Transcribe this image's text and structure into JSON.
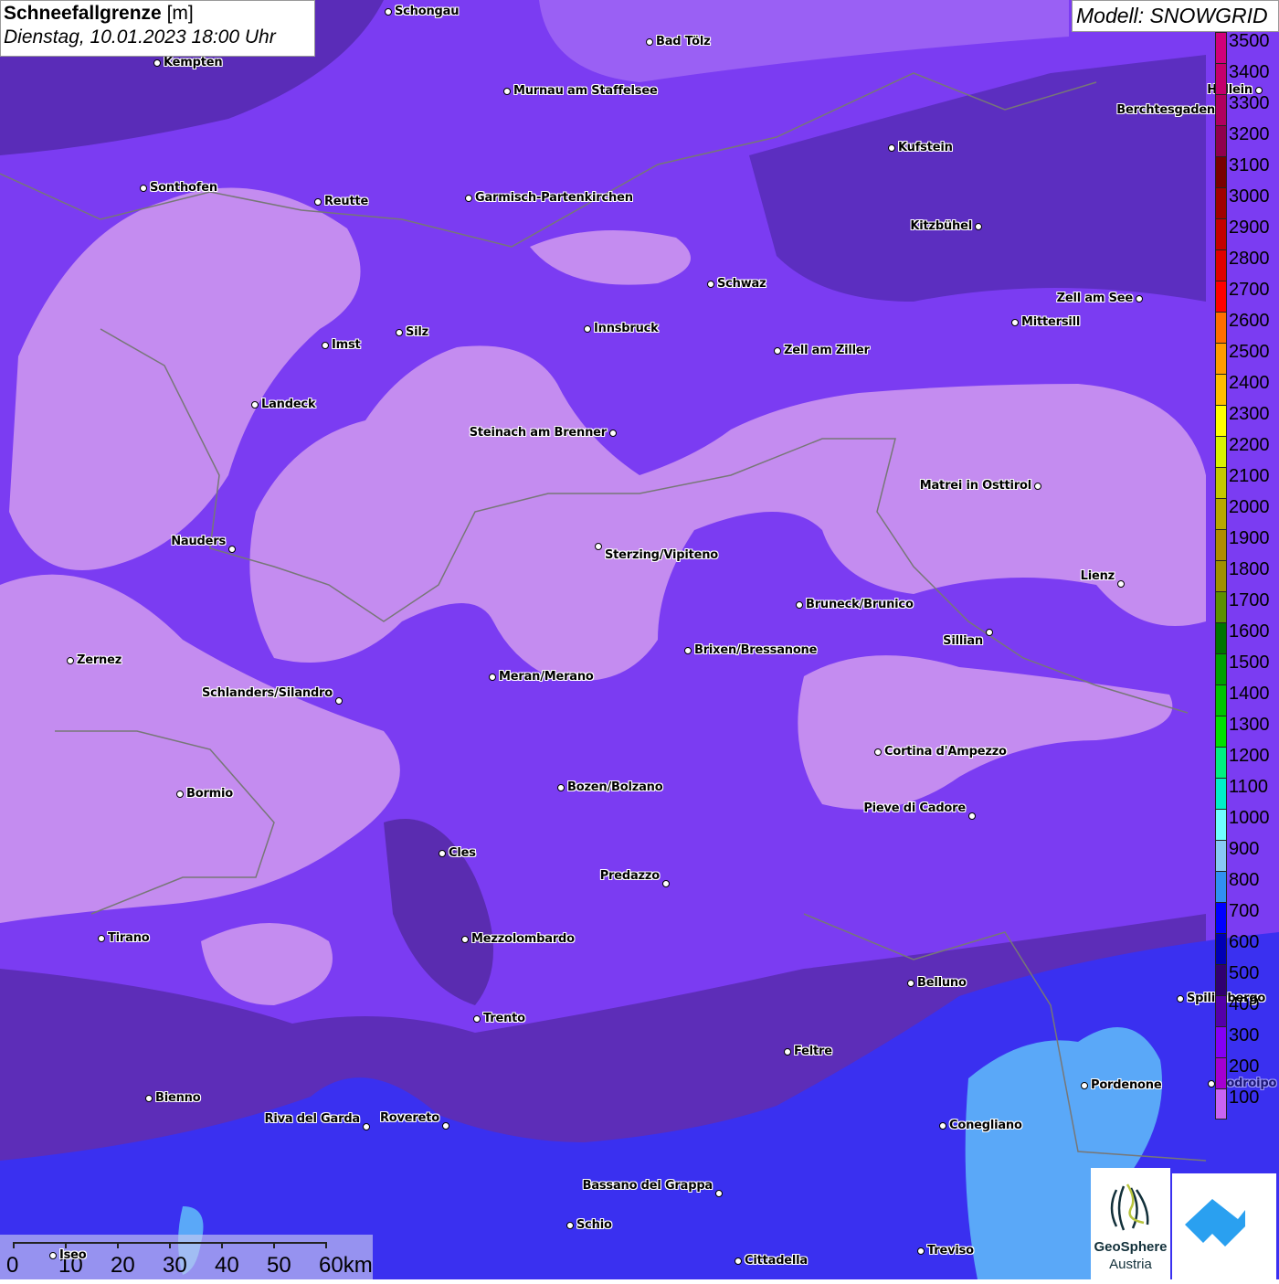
{
  "title": {
    "main": "Schneefallgrenze",
    "unit": "[m]",
    "datetime": "Dienstag, 10.01.2023 18:00 Uhr"
  },
  "model": "Modell: SNOWGRID",
  "legend": {
    "values": [
      "3500",
      "3400",
      "3300",
      "3200",
      "3100",
      "3000",
      "2900",
      "2800",
      "2700",
      "2600",
      "2500",
      "2400",
      "2300",
      "2200",
      "2100",
      "2000",
      "1900",
      "1800",
      "1700",
      "1600",
      "1500",
      "1400",
      "1300",
      "1200",
      "1100",
      "1000",
      "900",
      "800",
      "700",
      "600",
      "500",
      "400",
      "300",
      "200",
      "100"
    ],
    "colors": [
      "#d0007a",
      "#c4006c",
      "#b0005e",
      "#90004c",
      "#780000",
      "#a00000",
      "#c40000",
      "#e00000",
      "#ff0000",
      "#ff6e00",
      "#ff9c00",
      "#ffbe00",
      "#ffff00",
      "#d8f200",
      "#c4c800",
      "#b8a800",
      "#b08c00",
      "#a09000",
      "#5c9000",
      "#007400",
      "#00a000",
      "#00c400",
      "#00e000",
      "#00f080",
      "#00f0c8",
      "#70ffff",
      "#88c8f4",
      "#3090f2",
      "#0000ff",
      "#0000b4",
      "#300070",
      "#5400a8",
      "#8400f4",
      "#a400d0",
      "#c864f2"
    ]
  },
  "cities": [
    "Schongau",
    "Kempten",
    "Bad Tölz",
    "Murnau am Staffelsee",
    "Berchtesgaden",
    "Hallein",
    "Kufstein",
    "Sonthofen",
    "Reutte",
    "Garmisch-Partenkirchen",
    "Kitzbühel",
    "Schwaz",
    "Zell am See",
    "Innsbruck",
    "Mittersill",
    "Silz",
    "Imst",
    "Zell am Ziller",
    "Landeck",
    "Steinach am Brenner",
    "Matrei in Osttirol",
    "Nauders",
    "Sterzing/Vipiteno",
    "Lienz",
    "Bruneck/Brunico",
    "Sillian",
    "Brixen/Bressanone",
    "Zernez",
    "Meran/Merano",
    "Schlanders/Silandro",
    "Cortina d'Ampezzo",
    "Bozen/Bolzano",
    "Bormio",
    "Pieve di Cadore",
    "Cles",
    "Predazzo",
    "Tirano",
    "Mezzolombardo",
    "Belluno",
    "Spilimbergo",
    "Trento",
    "Feltre",
    "Pordenone",
    "Bienno",
    "Riva del Garda",
    "Rovereto",
    "Conegliano",
    "Bassano del Grappa",
    "Schio",
    "Iseo",
    "Treviso",
    "Cittadella",
    "Codroipo"
  ],
  "scale": {
    "labels": [
      "0",
      "10",
      "20",
      "30",
      "40",
      "50",
      "60km"
    ]
  },
  "logos": {
    "geosphere_line1": "GeoSphere",
    "geosphere_line2": "Austria"
  }
}
